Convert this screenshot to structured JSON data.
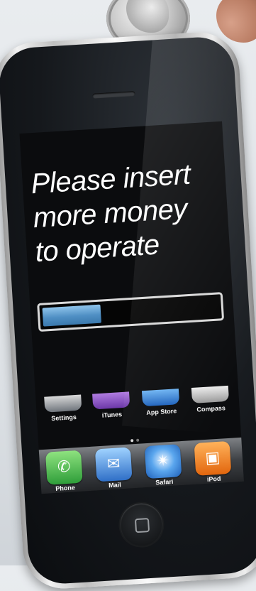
{
  "screen": {
    "message_lines": [
      "Please insert",
      "more money",
      "to operate"
    ],
    "progress": 0.33
  },
  "home_icons": [
    {
      "label": "Settings",
      "icon": "settings-icon",
      "color": "#8a8f96"
    },
    {
      "label": "iTunes",
      "icon": "itunes-icon",
      "color": "#7d4bb7"
    },
    {
      "label": "App Store",
      "icon": "app-store-icon",
      "color": "#2f78d0"
    },
    {
      "label": "Compass",
      "icon": "compass-icon",
      "color": "#c9c9c9"
    }
  ],
  "dock": [
    {
      "label": "Phone",
      "icon": "phone-icon",
      "color": "#3cb04a"
    },
    {
      "label": "Mail",
      "icon": "mail-icon",
      "color": "#3e86d8"
    },
    {
      "label": "Safari",
      "icon": "safari-icon",
      "color": "#3a8ee6"
    },
    {
      "label": "iPod",
      "icon": "ipod-icon",
      "color": "#f07a1a"
    }
  ]
}
